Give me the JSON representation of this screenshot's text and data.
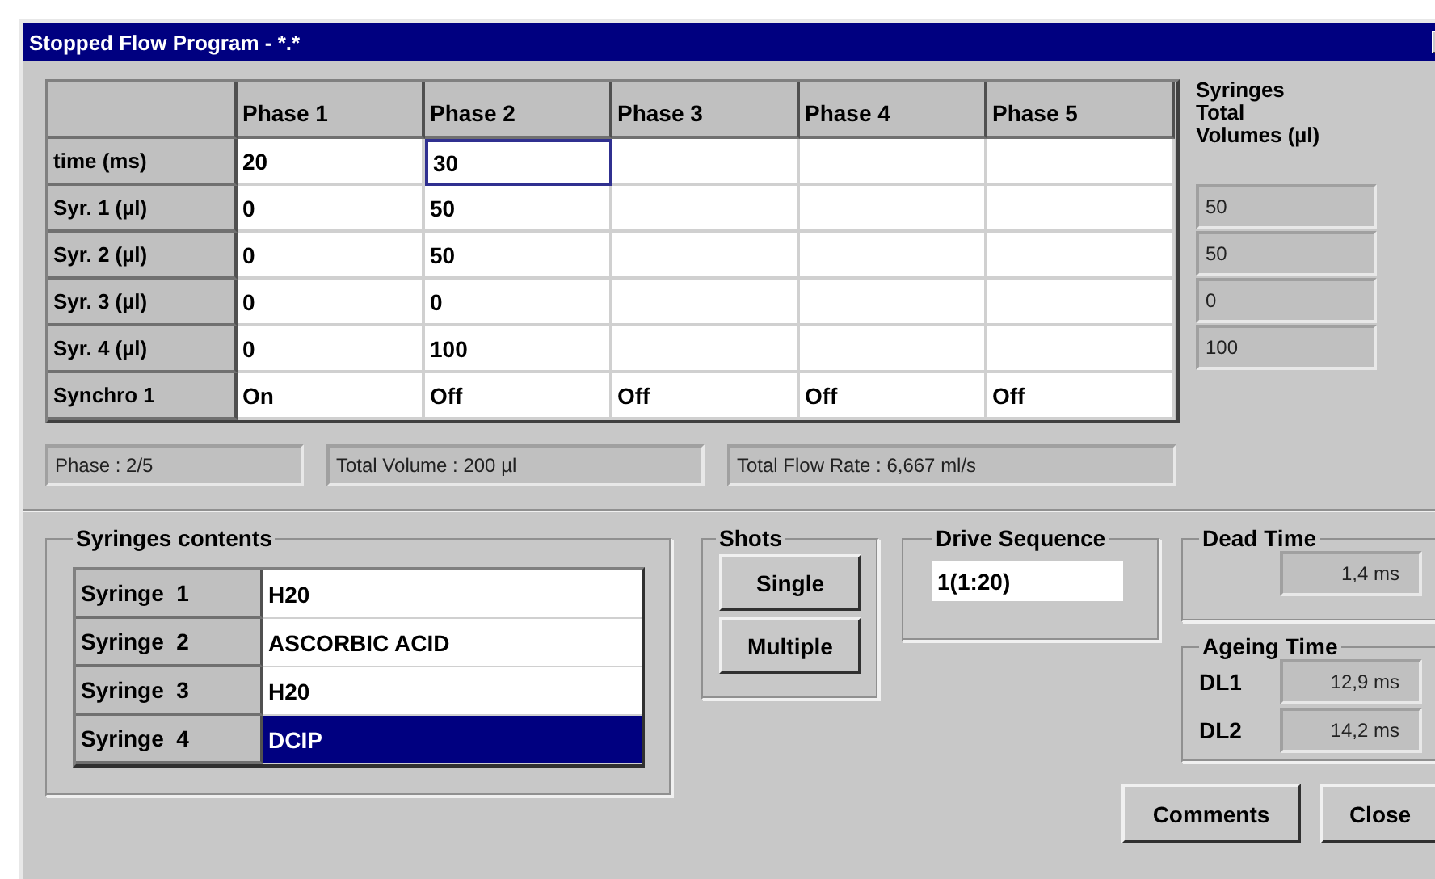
{
  "window": {
    "title": "Stopped Flow Program - *.*"
  },
  "program_table": {
    "columns": [
      "Phase 1",
      "Phase 2",
      "Phase 3",
      "Phase 4",
      "Phase 5"
    ],
    "rows": [
      {
        "label": "time (ms)",
        "cells": [
          {
            "value": "20",
            "focused": false
          },
          {
            "value": "30",
            "focused": true
          },
          {
            "focused": false
          },
          {
            "focused": false
          },
          {
            "focused": false
          }
        ]
      },
      {
        "label": "Syr. 1 (µl)",
        "cells": [
          {
            "value": "0",
            "focused": false
          },
          {
            "value": "50",
            "focused": false
          },
          {
            "focused": false
          },
          {
            "focused": false
          },
          {
            "focused": false
          }
        ]
      },
      {
        "label": "Syr. 2 (µl)",
        "cells": [
          {
            "value": "0",
            "focused": false
          },
          {
            "value": "50",
            "focused": false
          },
          {
            "focused": false
          },
          {
            "focused": false
          },
          {
            "focused": false
          }
        ]
      },
      {
        "label": "Syr. 3 (µl)",
        "cells": [
          {
            "value": "0",
            "focused": false
          },
          {
            "value": "0",
            "focused": false
          },
          {
            "focused": false
          },
          {
            "focused": false
          },
          {
            "focused": false
          }
        ]
      },
      {
        "label": "Syr. 4 (µl)",
        "cells": [
          {
            "value": "0",
            "focused": false
          },
          {
            "value": "100",
            "focused": false
          },
          {
            "focused": false
          },
          {
            "focused": false
          },
          {
            "focused": false
          }
        ]
      },
      {
        "label": "Synchro 1",
        "cells": [
          {
            "value": "On",
            "focused": false
          },
          {
            "value": "Off",
            "focused": false
          },
          {
            "value": "Off",
            "focused": false
          },
          {
            "value": "Off",
            "focused": false
          },
          {
            "value": "Off",
            "focused": false
          }
        ]
      }
    ]
  },
  "syringes_total": {
    "heading": "Syringes Total Volumes (µl)",
    "values": [
      "50",
      "50",
      "0",
      "100"
    ]
  },
  "status": [
    "Phase : 2/5",
    "Total Volume : 200 µl",
    "Total Flow Rate : 6,667 ml/s"
  ],
  "syringes_contents": {
    "title": "Syringes contents",
    "rows": [
      {
        "label": "Syringe  1",
        "content": "H20",
        "selected": false
      },
      {
        "label": "Syringe  2",
        "content": "ASCORBIC ACID",
        "selected": false
      },
      {
        "label": "Syringe  3",
        "content": "H20",
        "selected": false
      },
      {
        "label": "Syringe  4",
        "content": "DCIP",
        "selected": true
      }
    ]
  },
  "shots": {
    "title": "Shots",
    "buttons": [
      "Single",
      "Multiple"
    ]
  },
  "drive_sequence": {
    "title": "Drive Sequence",
    "value": "1(1:20)"
  },
  "dead_time": {
    "title": "Dead Time",
    "value": "1,4 ms"
  },
  "ageing_time": {
    "title": "Ageing Time",
    "rows": [
      {
        "label": "DL1",
        "value": "12,9 ms"
      },
      {
        "label": "DL2",
        "value": "14,2 ms"
      }
    ]
  },
  "buttons": [
    "Comments",
    "Close"
  ]
}
